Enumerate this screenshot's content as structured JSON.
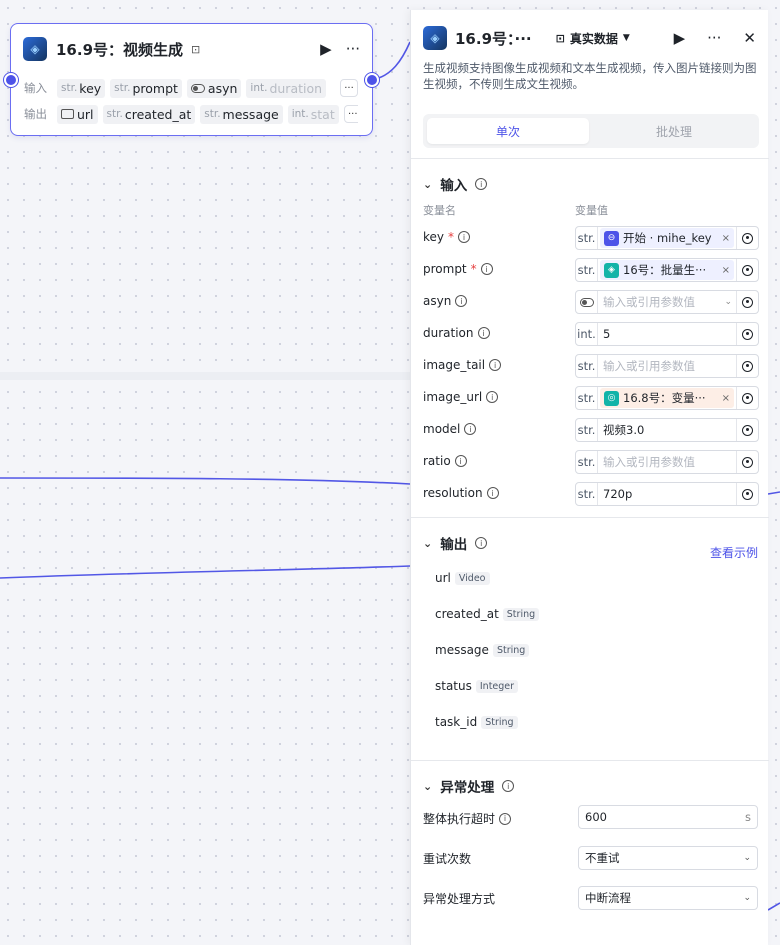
{
  "node": {
    "title": "16.9号：视频生成",
    "input_label": "输入",
    "output_label": "输出",
    "inputs": [
      {
        "type": "str.",
        "name": "key"
      },
      {
        "type": "str.",
        "name": "prompt"
      },
      {
        "type": "toggle",
        "name": "asyn"
      },
      {
        "type": "int.",
        "name": "duration"
      }
    ],
    "outputs": [
      {
        "type": "folder",
        "name": "url"
      },
      {
        "type": "str.",
        "name": "created_at"
      },
      {
        "type": "str.",
        "name": "message"
      },
      {
        "type": "int.",
        "name": "stat"
      }
    ],
    "more_label": "···"
  },
  "panel": {
    "title": "16.9号：···",
    "mode": "真实数据",
    "description": "生成视频支持图像生成视频和文本生成视频，传入图片链接则为图生视频，不传则生成文生视频。",
    "tabs": [
      "单次",
      "批处理"
    ],
    "input_section": "输入",
    "col_name": "变量名",
    "col_value": "变量值",
    "inputs": [
      {
        "name": "key",
        "required": true,
        "type": "str.",
        "kind": "chip",
        "chip_text": "开始 · mihe_key",
        "chip_icon": "⊖",
        "chip_color": "#4d53e8",
        "chip_style": "purple"
      },
      {
        "name": "prompt",
        "required": true,
        "type": "str.",
        "kind": "chip",
        "chip_text": "16号：批量生···",
        "chip_icon": "◈",
        "chip_color": "#12b3a8",
        "chip_style": "purple"
      },
      {
        "name": "asyn",
        "required": false,
        "type": "toggle",
        "kind": "placeholder-dd",
        "text": "输入或引用参数值"
      },
      {
        "name": "duration",
        "required": false,
        "type": "int.",
        "kind": "value",
        "text": "5"
      },
      {
        "name": "image_tail",
        "required": false,
        "type": "str.",
        "kind": "placeholder",
        "text": "输入或引用参数值"
      },
      {
        "name": "image_url",
        "required": false,
        "type": "str.",
        "kind": "chip",
        "chip_text": "16.8号：变量···",
        "chip_icon": "◎",
        "chip_color": "#12b3a8",
        "chip_style": "peach"
      },
      {
        "name": "model",
        "required": false,
        "type": "str.",
        "kind": "value",
        "text": "视频3.0"
      },
      {
        "name": "ratio",
        "required": false,
        "type": "str.",
        "kind": "placeholder",
        "text": "输入或引用参数值"
      },
      {
        "name": "resolution",
        "required": false,
        "type": "str.",
        "kind": "value",
        "text": "720p"
      }
    ],
    "output_section": "输出",
    "see_example": "查看示例",
    "outputs": [
      {
        "name": "url",
        "type": "Video"
      },
      {
        "name": "created_at",
        "type": "String"
      },
      {
        "name": "message",
        "type": "String"
      },
      {
        "name": "status",
        "type": "Integer"
      },
      {
        "name": "task_id",
        "type": "String"
      }
    ],
    "exception_section": "异常处理",
    "timeout_label": "整体执行超时",
    "timeout_value": "600",
    "timeout_unit": "s",
    "retry_label": "重试次数",
    "retry_value": "不重试",
    "handling_label": "异常处理方式",
    "handling_value": "中断流程"
  },
  "colors": {
    "accent": "#4d53e8",
    "wire": "#5257e6"
  }
}
